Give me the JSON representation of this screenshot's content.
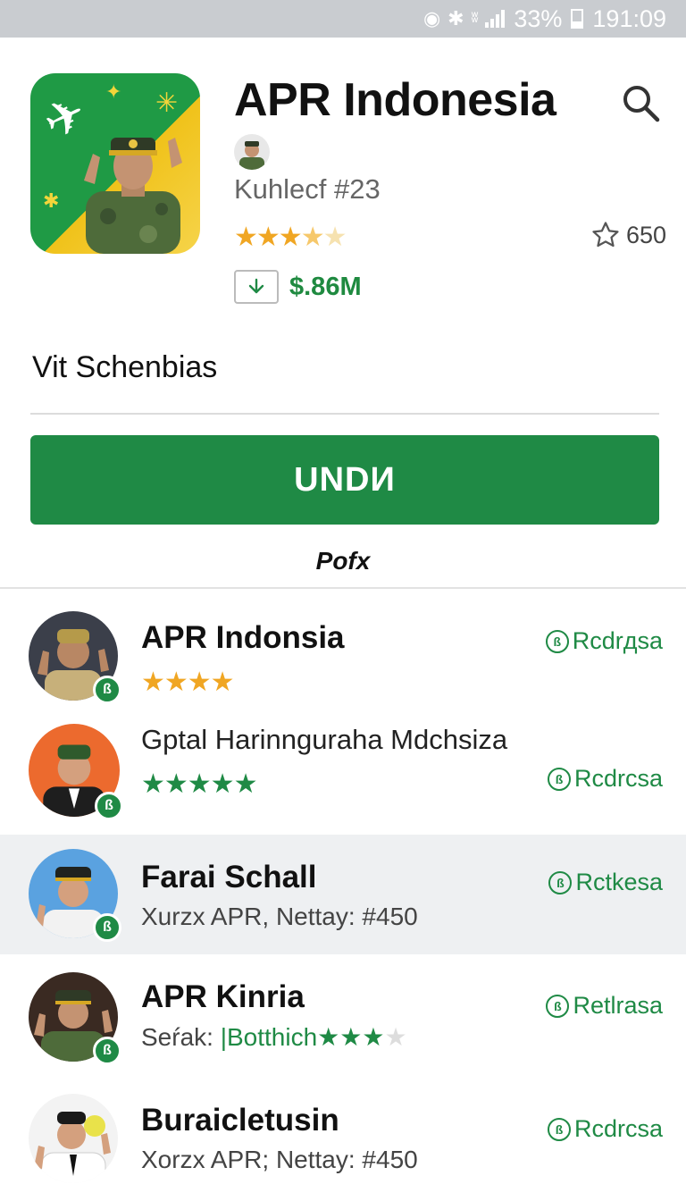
{
  "status_bar": {
    "battery": "33%",
    "time": "191:09"
  },
  "header": {
    "title": "APR Indonesia",
    "developer": "Kuhlecf #23",
    "rating_stars": "★★★★★",
    "favorites_count": "650",
    "downloads": "$.86M"
  },
  "section_heading": "Vit Schenbias",
  "install_button": "UNDИ",
  "sub_label": "Pofx",
  "colors": {
    "brand_green": "#1f8a45",
    "star_orange": "#f0a623"
  },
  "list": [
    {
      "title": "APR Indonsia",
      "stars": "★★★★",
      "stars_color": "orange",
      "action": "Rcdrдsa"
    },
    {
      "title": "Gptal Harinnguraha Mdchsiza",
      "stars": "★★★★★",
      "stars_color": "green",
      "action": "Rcdrcsa"
    },
    {
      "title": "Farai Schall",
      "subtitle": "Xurzx APR, Nettay: #450",
      "action": "Rctkesa"
    },
    {
      "title": "APR Kinria",
      "subtitle_prefix": "Seŕak:",
      "subtitle_link": "|Botthich",
      "subtitle_stars": "★★★",
      "action": "Retlrasa"
    },
    {
      "title": "Buraicletusin",
      "subtitle": "Xorzx APR; Nettay: #450",
      "action": "Rcdrcsa"
    }
  ]
}
